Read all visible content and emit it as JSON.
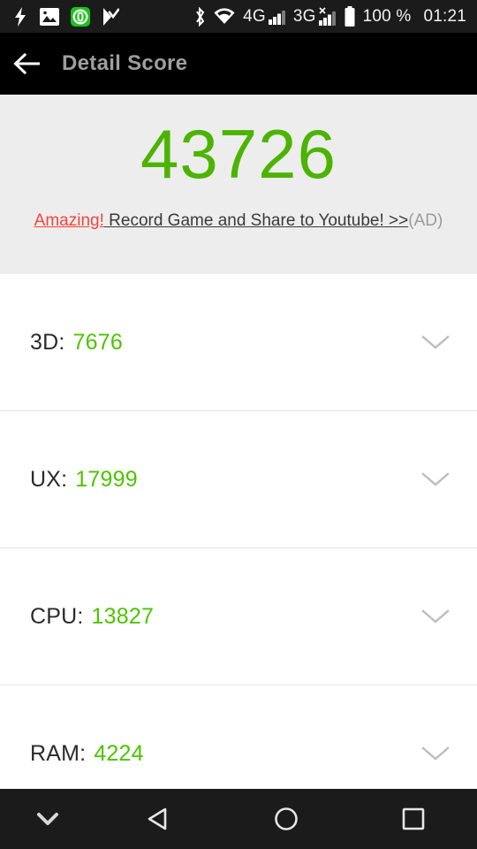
{
  "status_bar": {
    "left_icons": [
      {
        "name": "charging-bolt-icon",
        "glyph": "bolt"
      },
      {
        "name": "gallery-image-icon",
        "glyph": "image"
      },
      {
        "name": "antutu-app-icon",
        "glyph": "antutu"
      },
      {
        "name": "task-checkmark-icon",
        "glyph": "flag-check"
      }
    ],
    "right_icons": [
      {
        "name": "bluetooth-icon",
        "glyph": "bluetooth"
      },
      {
        "name": "wifi-icon",
        "glyph": "wifi"
      },
      {
        "name": "mobile-network-4g-icon",
        "glyph": "4G"
      },
      {
        "name": "mobile-network-3g-icon",
        "glyph": "3G"
      },
      {
        "name": "battery-icon",
        "glyph": "battery"
      }
    ],
    "network_4g_label": "4G",
    "network_3g_label": "3G",
    "battery_percent": "100 %",
    "clock": "01:21"
  },
  "app_bar": {
    "back_label": "back",
    "title": "Detail Score"
  },
  "score_panel": {
    "total_score": "43726",
    "ad": {
      "hook": "Amazing!",
      "body": " Record Game and Share to Youtube!",
      "arrows": " >>",
      "tag": "(AD)"
    }
  },
  "score_list": {
    "rows": [
      {
        "label": "3D:",
        "value": "7676",
        "expand_icon": "chevron-down-icon"
      },
      {
        "label": "UX:",
        "value": "17999",
        "expand_icon": "chevron-down-icon"
      },
      {
        "label": "CPU:",
        "value": "13827",
        "expand_icon": "chevron-down-icon"
      },
      {
        "label": "RAM:",
        "value": "4224",
        "expand_icon": "chevron-down-icon"
      }
    ]
  },
  "nav_bar": {
    "buttons": [
      {
        "name": "hide-keyboard-button",
        "glyph": "chevron-down"
      },
      {
        "name": "back-button",
        "glyph": "triangle-left"
      },
      {
        "name": "home-button",
        "glyph": "circle"
      },
      {
        "name": "recents-button",
        "glyph": "square"
      }
    ]
  },
  "colors": {
    "accent_green": "#4cb400",
    "value_green": "#4cc400",
    "ad_red": "#f4433c",
    "panel_bg": "#ededed",
    "bar_black": "#000000",
    "status_black": "#1b1b1b"
  }
}
